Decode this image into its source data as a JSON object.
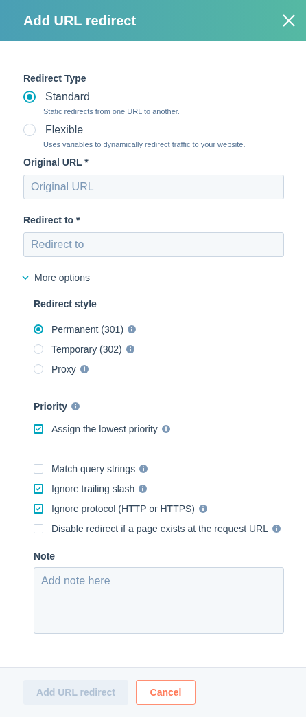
{
  "dialog": {
    "title": "Add URL redirect"
  },
  "redirect_type": {
    "label": "Redirect Type",
    "options": [
      {
        "label": "Standard",
        "description": "Static redirects from one URL to another.",
        "selected": true
      },
      {
        "label": "Flexible",
        "description": "Uses variables to dynamically redirect traffic to your website.",
        "selected": false
      }
    ]
  },
  "fields": [
    {
      "label": "Original URL *",
      "placeholder": "Original URL"
    },
    {
      "label": "Redirect to *",
      "placeholder": "Redirect to"
    }
  ],
  "more_options": {
    "label": "More options",
    "expanded": true
  },
  "redirect_style": {
    "label": "Redirect style",
    "options": [
      {
        "label": "Permanent (301)",
        "selected": true
      },
      {
        "label": "Temporary (302)",
        "selected": false
      },
      {
        "label": "Proxy",
        "selected": false
      }
    ]
  },
  "priority": {
    "label": "Priority",
    "options": [
      {
        "label": "Assign the lowest priority",
        "checked": true
      }
    ]
  },
  "settings": [
    {
      "label": "Match query strings",
      "checked": false
    },
    {
      "label": "Ignore trailing slash",
      "checked": true
    },
    {
      "label": "Ignore protocol (HTTP or HTTPS)",
      "checked": true
    },
    {
      "label": "Disable redirect if a page exists at the request URL",
      "checked": false
    }
  ],
  "note": {
    "label": "Note",
    "placeholder": "Add note here"
  },
  "footer": {
    "buttons": [
      {
        "label": "Add URL redirect",
        "kind": "primary",
        "disabled": true
      },
      {
        "label": "Cancel",
        "kind": "secondary",
        "disabled": false
      }
    ]
  }
}
